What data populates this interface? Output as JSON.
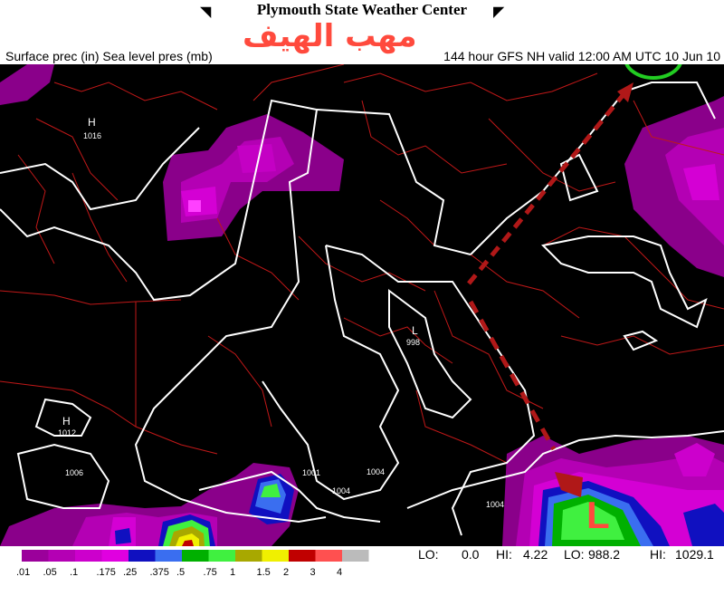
{
  "header": {
    "title": "Plymouth State Weather Center",
    "subtitle_left": "Surface prec (in) Sea level pres (mb)",
    "subtitle_right": "144 hour GFS NH valid 12:00 AM UTC 10 Jun 10",
    "overlay_arabic": "مهب الهيف"
  },
  "map": {
    "pressure_labels": [
      {
        "kind": "H",
        "value": "1016"
      },
      {
        "kind": "L",
        "value": "998"
      },
      {
        "kind": "H",
        "value": "1012"
      },
      {
        "kind": "",
        "value": "1006"
      },
      {
        "kind": "",
        "value": "1001"
      },
      {
        "kind": "",
        "value": "1004"
      },
      {
        "kind": "",
        "value": "1004"
      },
      {
        "kind": "",
        "value": "1004"
      }
    ],
    "annotation_letter": "L"
  },
  "legend": {
    "ticks": [
      ".01",
      ".05",
      ".1",
      ".175",
      ".25",
      ".375",
      ".5",
      ".75",
      "1",
      "1.5",
      "2",
      "3",
      "4"
    ],
    "colors": [
      "#9b009b",
      "#b400b4",
      "#cc00cc",
      "#e000e0",
      "#1010c0",
      "#3a6ef0",
      "#00b000",
      "#40f040",
      "#a8a800",
      "#f0f000",
      "#c00000",
      "#ff5050",
      "#bbbbbb"
    ],
    "lo1_label": "LO:",
    "lo1_value": "0.0",
    "hi1_label": "HI:",
    "hi1_value": "4.22",
    "lo2_label": "LO:",
    "lo2_value": "988.2",
    "hi2_label": "HI:",
    "hi2_value": "1029.1"
  },
  "colors": {
    "annotation_red": "#b01818",
    "circle_green": "#22cc22",
    "letter_red": "#ff4a3d"
  }
}
